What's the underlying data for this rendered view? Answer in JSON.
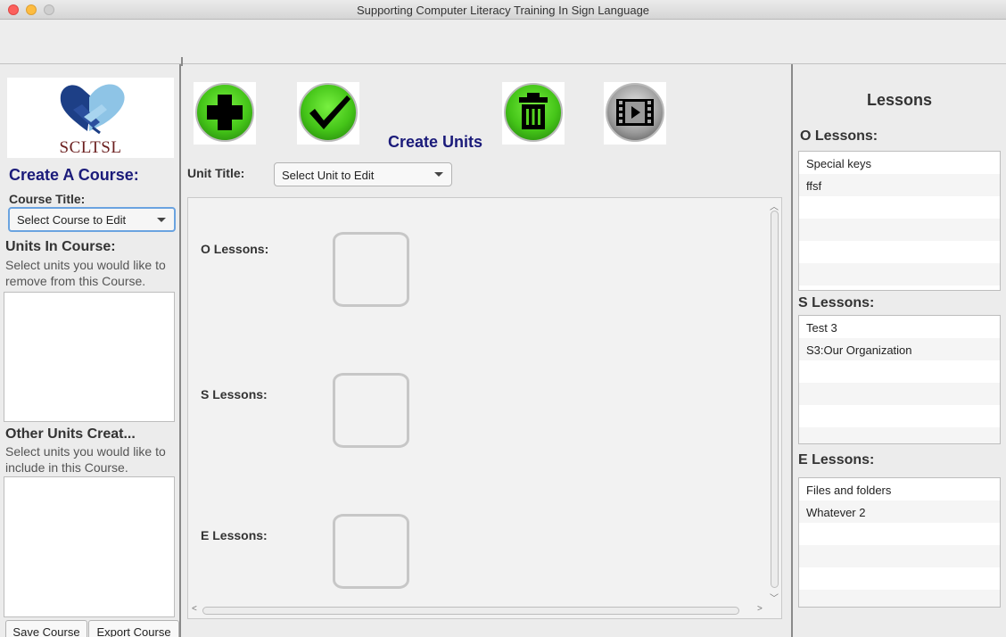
{
  "window": {
    "title": "Supporting Computer Literacy Training In Sign Language"
  },
  "left": {
    "logo_text": "SCLTSL",
    "create_course_heading": "Create A Course:",
    "course_title_label": "Course Title:",
    "course_select_value": "Select Course to Edit",
    "units_in_course_heading": "Units In Course:",
    "units_in_course_desc": "Select units you would like to remove from this Course.",
    "other_units_heading": "Other Units Creat...",
    "other_units_desc": "Select units you would like to include in this Course.",
    "save_button": "Save Course",
    "export_button": "Export Course"
  },
  "center": {
    "heading": "Create Units",
    "unit_title_label": "Unit Title:",
    "unit_select_value": "Select Unit to Edit",
    "o_label": "O Lessons:",
    "s_label": "S Lessons:",
    "e_label": "E Lessons:",
    "icons": [
      "add-icon",
      "check-icon",
      "trash-icon",
      "video-icon"
    ]
  },
  "right": {
    "heading": "Lessons",
    "o_heading": "O Lessons:",
    "o_items": [
      "Special keys",
      "ffsf"
    ],
    "s_heading": "S Lessons:",
    "s_items": [
      "Test 3",
      "S3:Our Organization"
    ],
    "e_heading": "E Lessons:",
    "e_items": [
      "Files and folders",
      "Whatever 2"
    ]
  },
  "colors": {
    "accent_heading": "#1b1b7a",
    "button_green": "#44c418",
    "focus_ring": "#6aa3e0"
  }
}
